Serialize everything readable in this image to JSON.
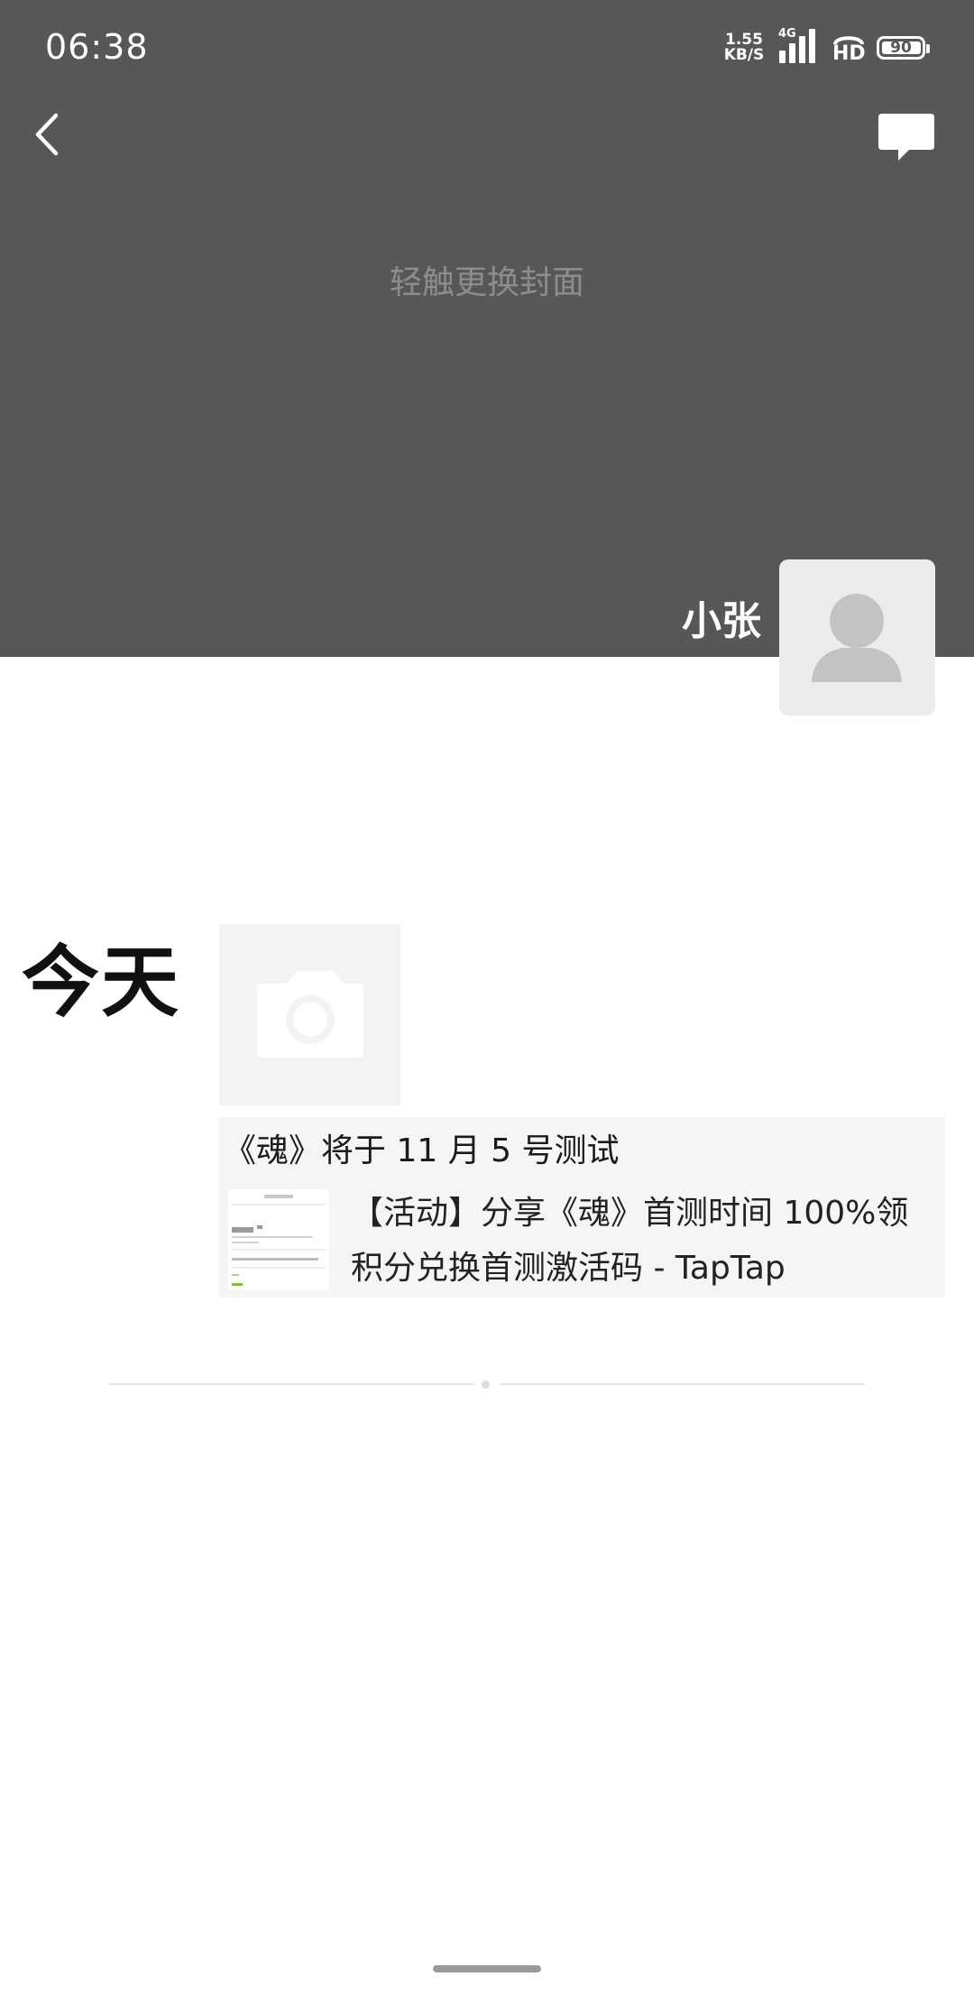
{
  "status_bar": {
    "time": "06:38",
    "net_speed_value": "1.55",
    "net_speed_unit": "KB/S",
    "network_type": "4G",
    "hd_label": "HD",
    "battery_percent": "90"
  },
  "header": {
    "back_icon": "chevron-left-icon",
    "message_icon": "chat-bubble-icon",
    "cover_hint": "轻触更换封面",
    "username": "小张",
    "avatar_icon": "default-person-icon"
  },
  "feed": {
    "day_label": "今天",
    "post": {
      "image_placeholder_icon": "camera-icon",
      "text": "《魂》将于 11 月 5 号测试",
      "share": {
        "title_line1": "【活动】分享《魂》首测时间 100%领",
        "title_line2": "积分兑换首测激活码 - TapTap"
      }
    }
  },
  "colors": {
    "cover_bg": "#575757",
    "cover_hint": "#8d8d8d",
    "share_card_bg": "#f5f5f5"
  }
}
